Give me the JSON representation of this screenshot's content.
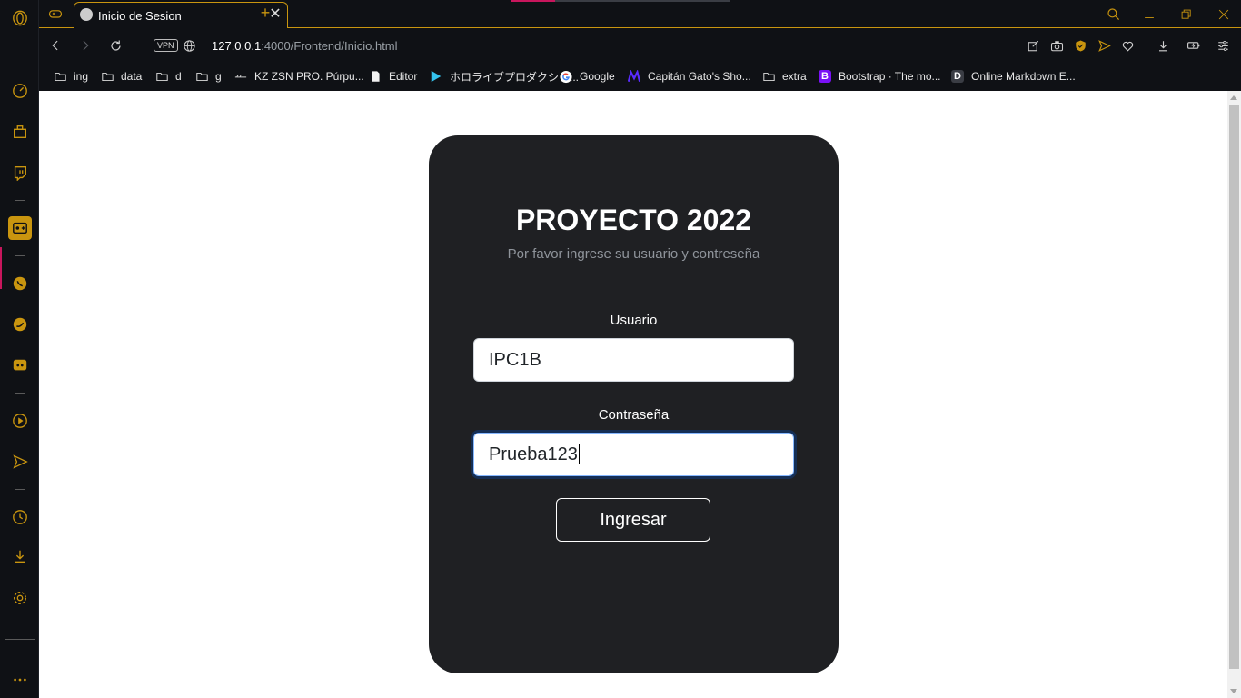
{
  "browser": {
    "tab": {
      "title": "Inicio de Sesion"
    },
    "url": {
      "host": "127.0.0.1",
      "rest": ":4000/Frontend/Inicio.html"
    },
    "vpn_label": "VPN",
    "accent_color": "#c9950f"
  },
  "bookmarks": [
    {
      "label": "ing",
      "icon": "folder-icon"
    },
    {
      "label": "data",
      "icon": "folder-icon"
    },
    {
      "label": "d",
      "icon": "folder-icon"
    },
    {
      "label": "g",
      "icon": "folder-icon"
    },
    {
      "label": "KZ ZSN PRO. Púrpu...",
      "icon": "site-icon"
    },
    {
      "label": "Editor",
      "icon": "document-icon"
    },
    {
      "label": "ホロライブプロダクショ...",
      "icon": "play-icon"
    },
    {
      "label": "Google",
      "icon": "google-icon"
    },
    {
      "label": "Capitán Gato's Sho...",
      "icon": "m-icon"
    },
    {
      "label": "extra",
      "icon": "folder-icon"
    },
    {
      "label": "Bootstrap · The mo...",
      "icon": "bootstrap-icon"
    },
    {
      "label": "Online Markdown E...",
      "icon": "d-icon"
    }
  ],
  "login": {
    "title": "PROYECTO 2022",
    "subtitle": "Por favor ingrese su usuario y contreseña",
    "user_label": "Usuario",
    "user_value": "IPC1B",
    "password_label": "Contraseña",
    "password_value": "Prueba123",
    "submit_label": "Ingresar"
  }
}
